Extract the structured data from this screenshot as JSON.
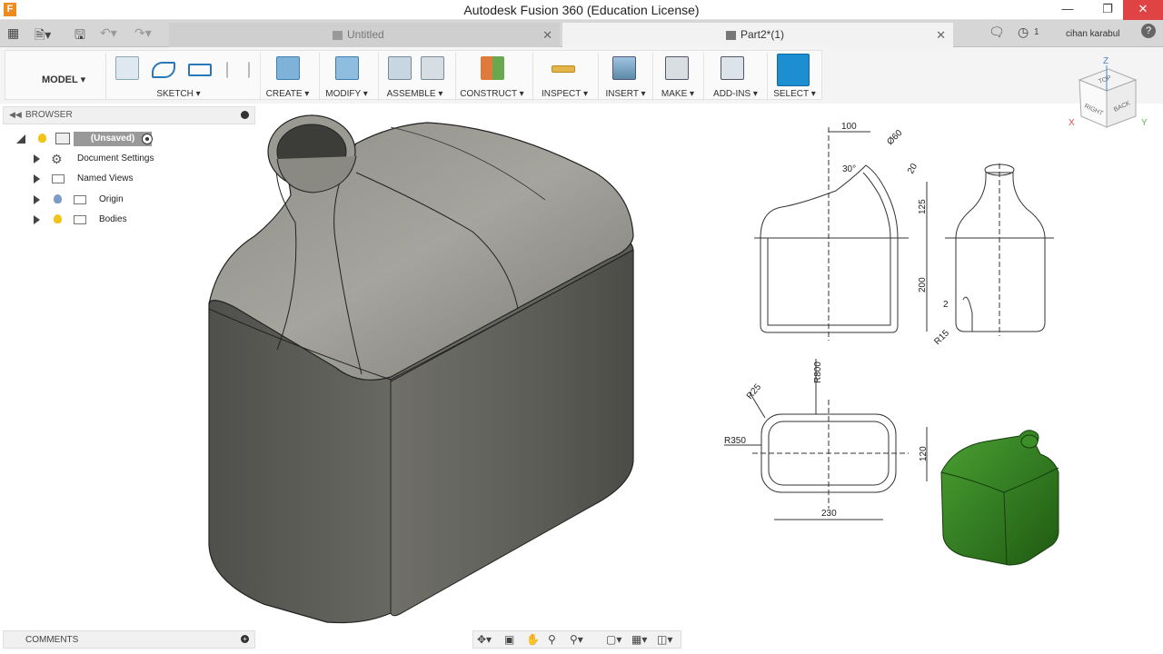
{
  "window": {
    "title": "Autodesk Fusion 360 (Education License)",
    "logo": "F"
  },
  "tabs": [
    {
      "label": "Untitled",
      "active": false
    },
    {
      "label": "Part2*(1)",
      "active": true
    }
  ],
  "header": {
    "notifications": "1",
    "user": "cihan karabul",
    "help": "?"
  },
  "toolbar": {
    "workspace": "MODEL",
    "groups": {
      "sketch": "SKETCH",
      "create": "CREATE",
      "modify": "MODIFY",
      "assemble": "ASSEMBLE",
      "construct": "CONSTRUCT",
      "inspect": "INSPECT",
      "insert": "INSERT",
      "make": "MAKE",
      "addins": "ADD-INS",
      "select": "SELECT"
    }
  },
  "browser": {
    "title": "BROWSER",
    "root": "(Unsaved)",
    "items": [
      "Document Settings",
      "Named Views",
      "Origin",
      "Bodies"
    ]
  },
  "comments": {
    "label": "COMMENTS"
  },
  "viewcube": {
    "top": "TOP",
    "right": "RIGHT",
    "back": "BACK",
    "axis_z": "Z",
    "axis_x": "X",
    "axis_y": "Y"
  },
  "drawing": {
    "dims": {
      "d100": "100",
      "d60": "Ø60",
      "d30": "30°",
      "d20": "20",
      "d125": "125",
      "d200": "200",
      "d2": "2",
      "r15": "R15",
      "r800": "R800",
      "r25": "R25",
      "r350": "R350",
      "d120": "120",
      "d230": "230"
    }
  },
  "colors": {
    "accent": "#1d8fd1",
    "body_gray": "#6b6b65",
    "preview_green": "#2e7d1e"
  }
}
